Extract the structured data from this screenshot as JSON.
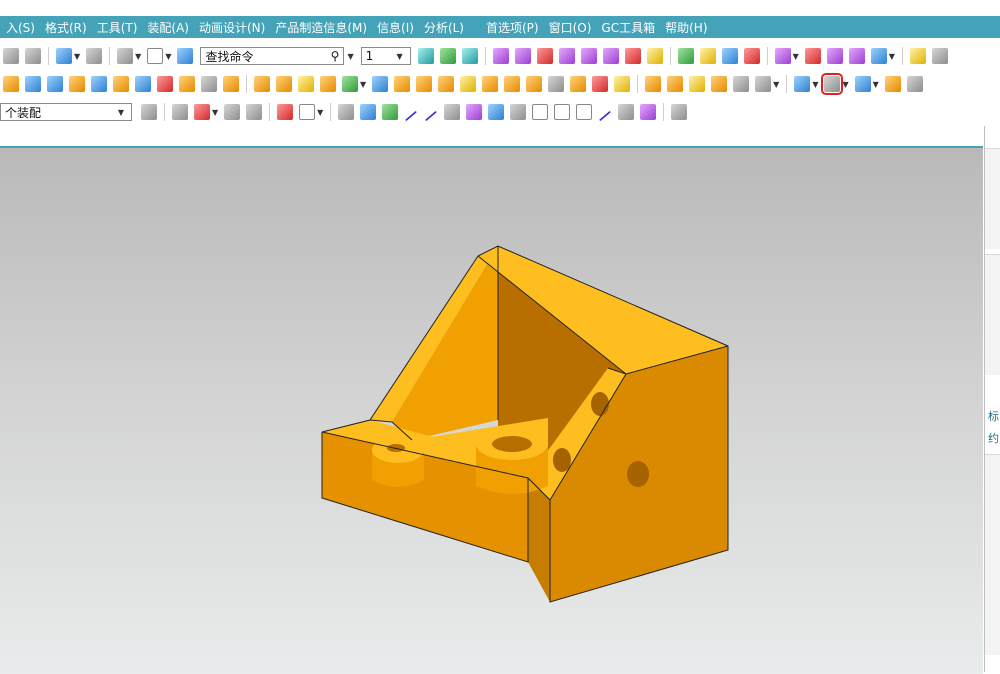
{
  "menu": [
    {
      "label": "入(S)"
    },
    {
      "label": "格式(R)"
    },
    {
      "label": "工具(T)"
    },
    {
      "label": "装配(A)"
    },
    {
      "label": "动画设计(N)"
    },
    {
      "label": "产品制造信息(M)"
    },
    {
      "label": "信息(I)"
    },
    {
      "label": "分析(L)"
    },
    {
      "label": "首选项(P)"
    },
    {
      "label": "窗口(O)"
    },
    {
      "label": "GC工具箱"
    },
    {
      "label": "帮助(H)"
    }
  ],
  "toolbar": {
    "search_label": "查找命令",
    "selection_value": "1"
  },
  "assembly_select": {
    "value": "个装配"
  },
  "colors": {
    "menubar": "#44a3b8",
    "model_light": "#ffbe1f",
    "model_mid": "#f0a000",
    "model_dark": "#b87200",
    "highlight": "#e02020"
  },
  "icons": {
    "highlighted": "shaded-with-edges-icon"
  },
  "right_panel": {
    "labels": [
      "标",
      "约"
    ]
  }
}
